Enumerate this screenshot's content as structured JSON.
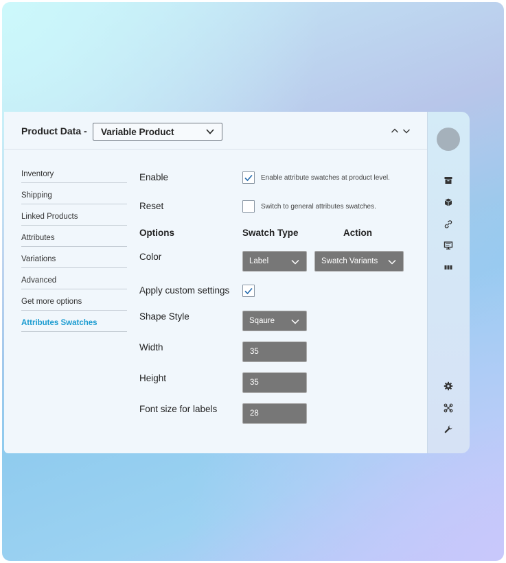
{
  "header": {
    "label": "Product Data -",
    "product_type": "Variable Product"
  },
  "nav": {
    "items": [
      {
        "label": "Inventory"
      },
      {
        "label": "Shipping"
      },
      {
        "label": "Linked Products"
      },
      {
        "label": "Attributes"
      },
      {
        "label": "Variations"
      },
      {
        "label": "Advanced"
      },
      {
        "label": "Get more options"
      },
      {
        "label": "Attributes Swatches"
      }
    ],
    "active_index": 7
  },
  "form": {
    "enable": {
      "label": "Enable",
      "checked": true,
      "text": "Enable attribute swatches at product level."
    },
    "reset": {
      "label": "Reset",
      "checked": false,
      "text": "Switch to general attributes swatches."
    },
    "options_header": {
      "options": "Options",
      "swatch_type": "Swatch Type",
      "action": "Action"
    },
    "color": {
      "label": "Color",
      "swatch_type": "Label",
      "action": "Swatch Variants"
    },
    "custom": {
      "label": "Apply custom settings",
      "checked": true
    },
    "shape": {
      "label": "Shape Style",
      "value": "Sqaure"
    },
    "width": {
      "label": "Width",
      "value": "35"
    },
    "height": {
      "label": "Height",
      "value": "35"
    },
    "font_size": {
      "label": "Font size for labels",
      "value": "28"
    }
  },
  "rail": {
    "icons": [
      "archive-icon",
      "box-icon",
      "link-icon",
      "monitor-icon",
      "grid-icon",
      "gear-icon",
      "network-icon",
      "wrench-icon"
    ]
  },
  "colors": {
    "accent": "#1a9bd0",
    "checkbox_check": "#2a6fb0",
    "control_dark": "#777777"
  }
}
